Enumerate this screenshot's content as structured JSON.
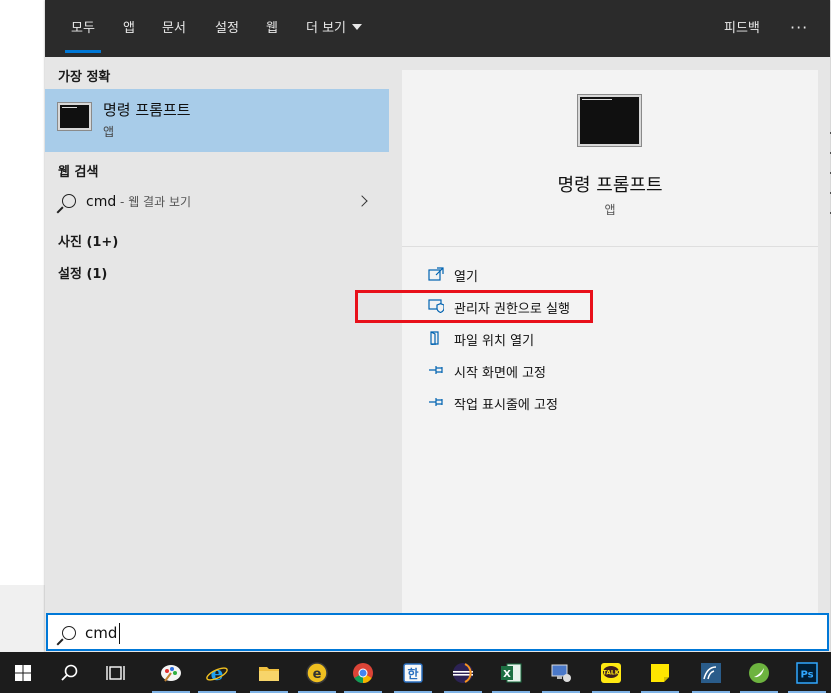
{
  "tabs": [
    {
      "label": "모두",
      "active": true
    },
    {
      "label": "앱"
    },
    {
      "label": "문서"
    },
    {
      "label": "설정"
    },
    {
      "label": "웹"
    },
    {
      "label": "더 보기"
    }
  ],
  "feedback_label": "피드백",
  "more_options_label": "···",
  "sections": {
    "best_match": "가장 정확",
    "web_search": "웹 검색",
    "photos": "사진 (1+)",
    "settings": "설정 (1)"
  },
  "best_match_item": {
    "name": "명령 프롬프트",
    "type": "앱",
    "icon": "cmd-icon"
  },
  "web_result": {
    "query": "cmd",
    "suffix": " - 웹 결과 보기"
  },
  "preview": {
    "name": "명령 프롬프트",
    "type": "앱"
  },
  "actions": [
    {
      "label": "열기",
      "icon": "open-icon"
    },
    {
      "label": "관리자 권한으로 실행",
      "icon": "shield-icon",
      "highlighted": true
    },
    {
      "label": "파일 위치 열기",
      "icon": "file-location-icon"
    },
    {
      "label": "시작 화면에 고정",
      "icon": "pin-icon"
    },
    {
      "label": "작업 표시줄에 고정",
      "icon": "pin-icon"
    }
  ],
  "search": {
    "value": "cmd"
  },
  "colors": {
    "accent": "#0078d7",
    "selection": "#a8cce9",
    "highlight_border": "#e8101a",
    "topbar": "#2b2b2b"
  },
  "taskbar_apps": [
    "windows-start",
    "search",
    "task-view",
    "paint",
    "internet-explorer",
    "file-explorer",
    "quick-launch",
    "chrome",
    "hangul",
    "eclipse",
    "excel",
    "network",
    "kakaotalk",
    "sticky-notes",
    "mysql-workbench",
    "spring",
    "photoshop"
  ]
}
